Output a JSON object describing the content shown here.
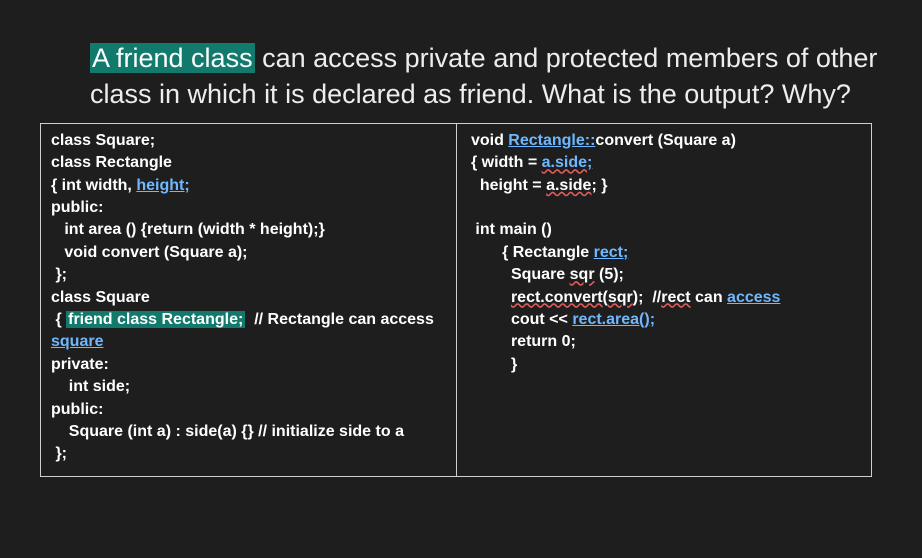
{
  "intro": {
    "highlight": "A friend class",
    "rest": " can access private and protected members of other class in which it is declared as friend. What is the output? Why?"
  },
  "code": {
    "left": {
      "l1": "class Square;",
      "l2": "class Rectangle",
      "l3a": "{ int width, ",
      "l3b": "height;",
      "l4": "public:",
      "l5": "   int area () {return (width * height);}",
      "l6": "   void convert (Square a);",
      "l7": " };",
      "l8": "class Square",
      "l9a": " { ",
      "l9b": "friend class Rectangle;",
      "l9c": "  // Rectangle can access ",
      "l9d": "square",
      "l10": "private:",
      "l11": "    int side;",
      "l12": "public:",
      "l13": "    Square (int a) : side(a) {} // initialize side to a",
      "l14": " };"
    },
    "right": {
      "l1a": " void ",
      "l1b": "Rectangle::",
      "l1c": "convert (Square a)",
      "l2a": " { width = ",
      "l2b": "a.side",
      "l2c": ";",
      "l3a": "   height = ",
      "l3b": "a.side",
      "l3c": "; }",
      "blank": "",
      "l4": "  int main ()",
      "l5a": "        { Rectangle ",
      "l5b": "rect;",
      "l6a": "          Square ",
      "l6b": "sqr",
      "l6c": " (5);",
      "l7a": "          ",
      "l7b": "rect.convert",
      "l7c": "(",
      "l7d": "sqr",
      "l7e": ");  //",
      "l7f": "rect",
      "l7g": " can ",
      "l7h": "access",
      "l8a": "          cout << ",
      "l8b": "rect.area(",
      "l8c": ");",
      "l9": "          return 0;",
      "l10": "          }"
    }
  }
}
